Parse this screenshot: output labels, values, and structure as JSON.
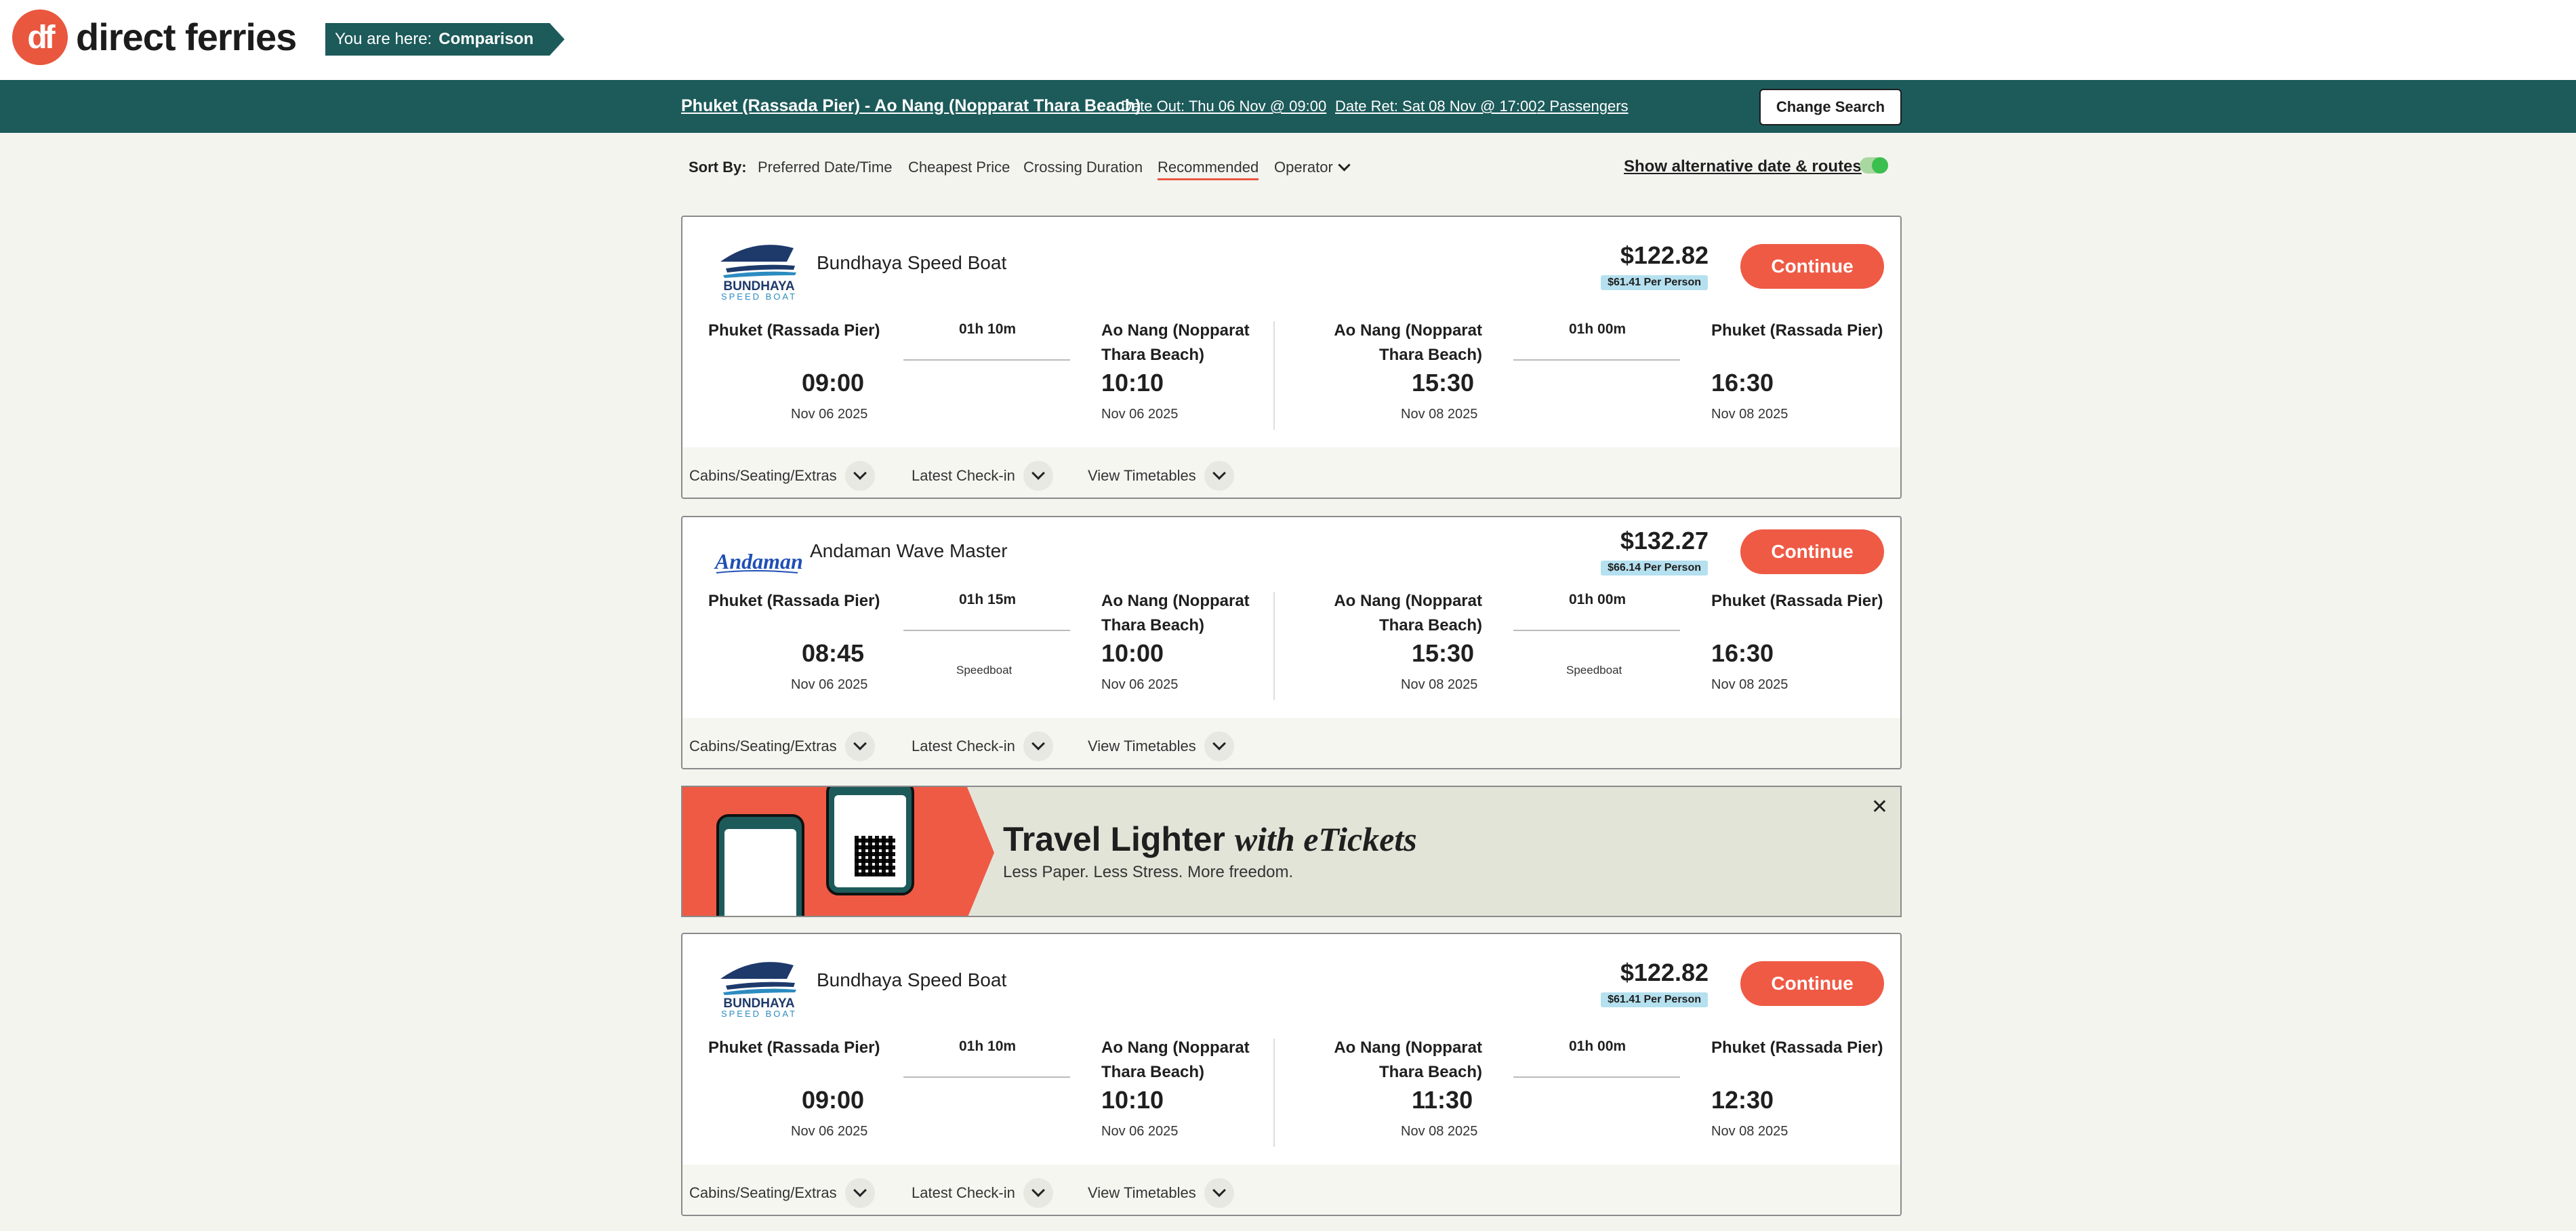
{
  "brand": {
    "logo_mark": "df",
    "name": "direct ferries",
    "accent": "#e9573f",
    "teal": "#1d5a5a"
  },
  "breadcrumb": {
    "prefix": "You are here:",
    "current": "Comparison"
  },
  "summary": {
    "route": "Phuket (Rassada Pier) - Ao Nang (Nopparat Thara Beach)",
    "date_out": "Date Out: Thu 06 Nov @ 09:00",
    "date_ret": "Date Ret: Sat 08 Nov @ 17:00",
    "passengers": "2 Passengers",
    "change_label": "Change Search"
  },
  "sort": {
    "label": "Sort By:",
    "options": [
      "Preferred Date/Time",
      "Cheapest Price",
      "Crossing Duration",
      "Recommended",
      "Operator"
    ],
    "active": "Recommended",
    "alt_label": "Show alternative date & routes",
    "alt_enabled": true
  },
  "results": [
    {
      "operator": "Bundhaya Speed Boat",
      "logo": "bundhaya-logo",
      "logo_text": [
        "BUNDHAYA",
        "SPEED BOAT"
      ],
      "price": "$122.82",
      "per_person": "$61.41 Per Person",
      "continue_label": "Continue",
      "outbound": {
        "from": "Phuket (Rassada Pier)",
        "to": "Ao Nang (Nopparat Thara Beach)",
        "duration": "01h 10m",
        "vessel": "",
        "depart": "09:00",
        "depart_date": "Nov 06 2025",
        "arrive": "10:10",
        "arrive_date": "Nov 06 2025"
      },
      "return": {
        "from": "Ao Nang (Nopparat Thara Beach)",
        "to": "Phuket (Rassada Pier)",
        "duration": "01h 00m",
        "vessel": "",
        "depart": "15:30",
        "depart_date": "Nov 08 2025",
        "arrive": "16:30",
        "arrive_date": "Nov 08 2025"
      },
      "footer": [
        "Cabins/Seating/Extras",
        "Latest Check-in",
        "View Timetables"
      ]
    },
    {
      "operator": "Andaman Wave Master",
      "logo": "andaman-logo",
      "logo_text": [
        "Andaman"
      ],
      "price": "$132.27",
      "per_person": "$66.14 Per Person",
      "continue_label": "Continue",
      "outbound": {
        "from": "Phuket (Rassada Pier)",
        "to": "Ao Nang (Nopparat Thara Beach)",
        "duration": "01h 15m",
        "vessel": "Speedboat",
        "depart": "08:45",
        "depart_date": "Nov 06 2025",
        "arrive": "10:00",
        "arrive_date": "Nov 06 2025"
      },
      "return": {
        "from": "Ao Nang (Nopparat Thara Beach)",
        "to": "Phuket (Rassada Pier)",
        "duration": "01h 00m",
        "vessel": "Speedboat",
        "depart": "15:30",
        "depart_date": "Nov 08 2025",
        "arrive": "16:30",
        "arrive_date": "Nov 08 2025"
      },
      "footer": [
        "Cabins/Seating/Extras",
        "Latest Check-in",
        "View Timetables"
      ]
    },
    {
      "operator": "Bundhaya Speed Boat",
      "logo": "bundhaya-logo",
      "logo_text": [
        "BUNDHAYA",
        "SPEED BOAT"
      ],
      "price": "$122.82",
      "per_person": "$61.41 Per Person",
      "continue_label": "Continue",
      "outbound": {
        "from": "Phuket (Rassada Pier)",
        "to": "Ao Nang (Nopparat Thara Beach)",
        "duration": "01h 10m",
        "vessel": "",
        "depart": "09:00",
        "depart_date": "Nov 06 2025",
        "arrive": "10:10",
        "arrive_date": "Nov 06 2025"
      },
      "return": {
        "from": "Ao Nang (Nopparat Thara Beach)",
        "to": "Phuket (Rassada Pier)",
        "duration": "01h 00m",
        "vessel": "",
        "depart": "11:30",
        "depart_date": "Nov 08 2025",
        "arrive": "12:30",
        "arrive_date": "Nov 08 2025"
      },
      "footer": [
        "Cabins/Seating/Extras",
        "Latest Check-in",
        "View Timetables"
      ]
    }
  ],
  "promo": {
    "headline_main": "Travel Lighter",
    "headline_em": "with eTickets",
    "sub": "Less Paper. Less Stress. More freedom.",
    "close_icon": "close-icon"
  }
}
